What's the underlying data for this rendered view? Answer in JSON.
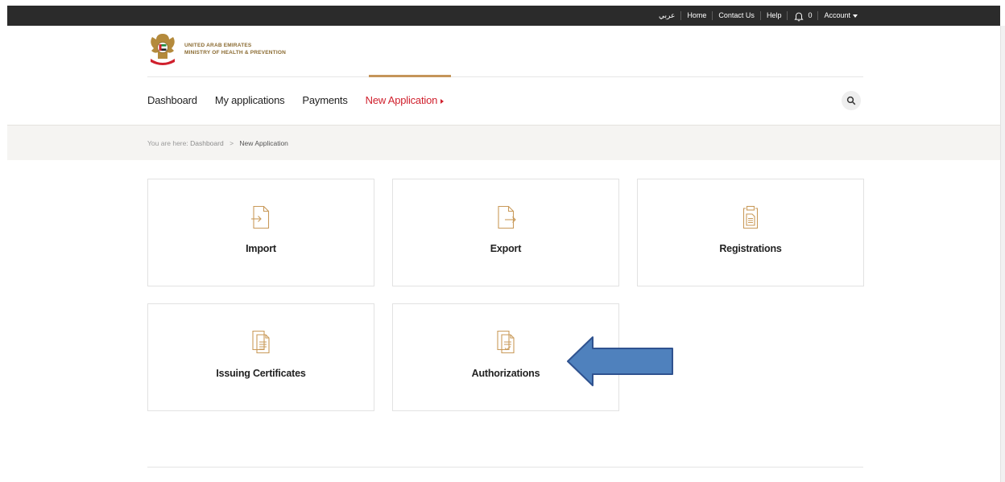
{
  "topbar": {
    "arabic": "عربي",
    "home": "Home",
    "contact": "Contact Us",
    "help": "Help",
    "notifications": "0",
    "account": "Account"
  },
  "logo": {
    "line1": "UNITED ARAB EMIRATES",
    "line2": "MINISTRY OF HEALTH & PREVENTION"
  },
  "nav": {
    "items": [
      {
        "label": "Dashboard"
      },
      {
        "label": "My applications"
      },
      {
        "label": "Payments"
      },
      {
        "label": "New Application"
      }
    ]
  },
  "breadcrumb": {
    "prefix": "You are here:",
    "link": "Dashboard",
    "separator": ">",
    "current": "New Application"
  },
  "tiles": [
    {
      "label": "Import",
      "icon": "file-import-icon"
    },
    {
      "label": "Export",
      "icon": "file-export-icon"
    },
    {
      "label": "Registrations",
      "icon": "clipboard-icon"
    },
    {
      "label": "Issuing Certificates",
      "icon": "document-icon"
    },
    {
      "label": "Authorizations",
      "icon": "document-check-icon"
    }
  ],
  "colors": {
    "topbar": "#2b2b2b",
    "accent": "#c5955a",
    "active_nav": "#d0202d",
    "icon": "#c99a5a",
    "annotation_arrow": "#4f81bd"
  }
}
